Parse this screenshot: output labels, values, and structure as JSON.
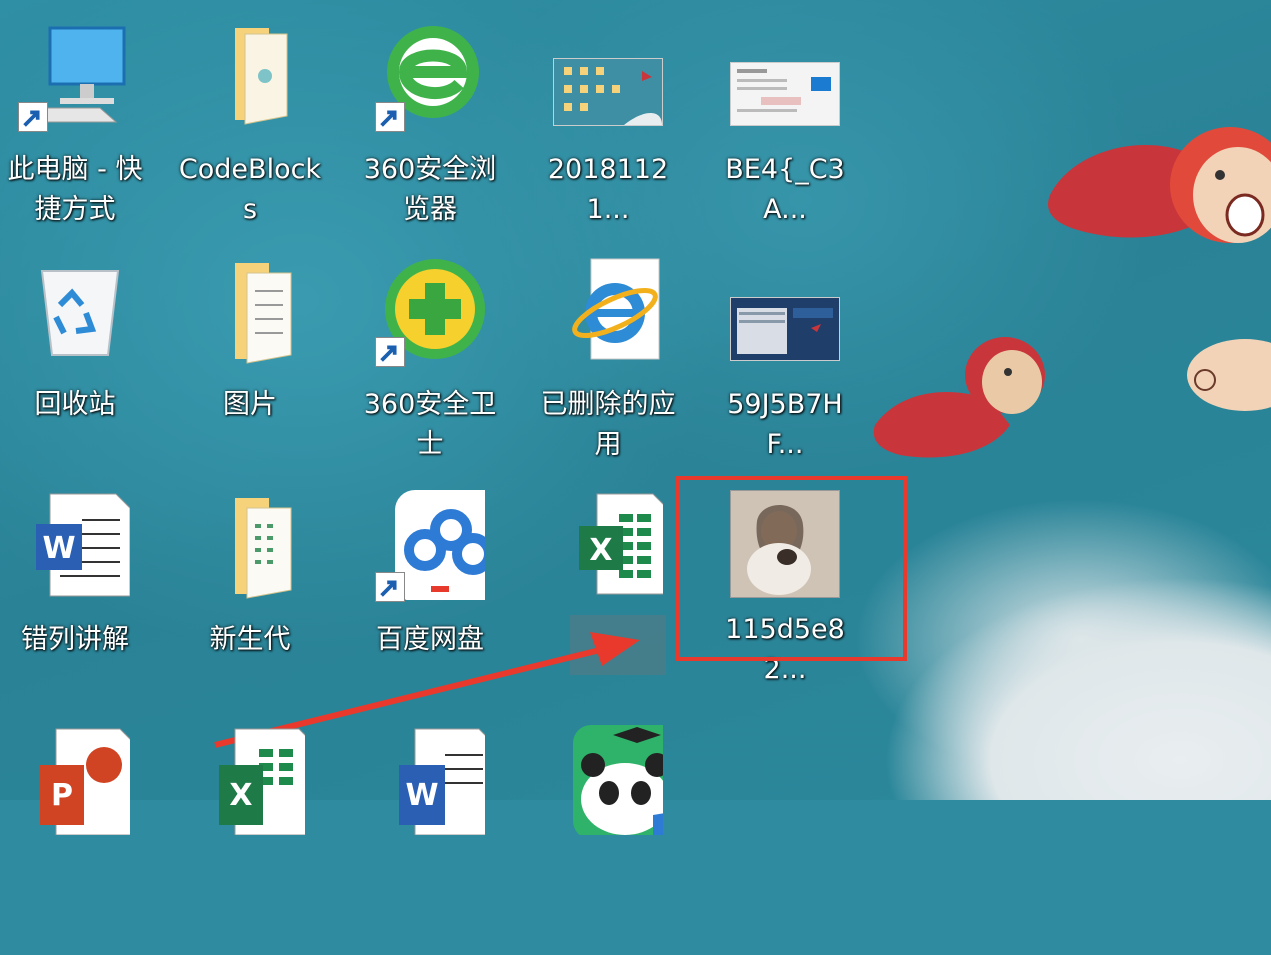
{
  "desktop": {
    "icons": [
      {
        "label": "此电脑 - 快捷方式",
        "icon": "computer-icon",
        "shortcut": true
      },
      {
        "label": "CodeBlocks",
        "icon": "folder-icon",
        "shortcut": false
      },
      {
        "label": "360安全浏览器",
        "icon": "360-browser-icon",
        "shortcut": true
      },
      {
        "label": "20181121...",
        "icon": "image-thumbnail-icon",
        "shortcut": false
      },
      {
        "label": "BE4{_C3A...",
        "icon": "image-thumbnail-icon",
        "shortcut": false
      },
      {
        "label": "回收站",
        "icon": "recycle-bin-icon",
        "shortcut": false
      },
      {
        "label": "图片",
        "icon": "folder-icon",
        "shortcut": false
      },
      {
        "label": "360安全卫士",
        "icon": "360-safe-icon",
        "shortcut": true
      },
      {
        "label": "已删除的应用",
        "icon": "ie-icon",
        "shortcut": false
      },
      {
        "label": "59J5B7HF...",
        "icon": "image-thumbnail-icon",
        "shortcut": false
      },
      {
        "label": "错列讲解",
        "icon": "word-doc-icon",
        "shortcut": false
      },
      {
        "label": "新生代",
        "icon": "folder-icon",
        "shortcut": false
      },
      {
        "label": "百度网盘",
        "icon": "baidu-netdisk-icon",
        "shortcut": true
      },
      {
        "label": "",
        "icon": "excel-doc-icon",
        "shortcut": false
      },
      {
        "label": "115d5e82...",
        "icon": "photo-thumbnail-icon",
        "shortcut": false
      }
    ]
  },
  "colors": {
    "highlight_box": "#e8392c",
    "arrow": "#e8392c",
    "wallpaper": "#2f8ca0"
  }
}
